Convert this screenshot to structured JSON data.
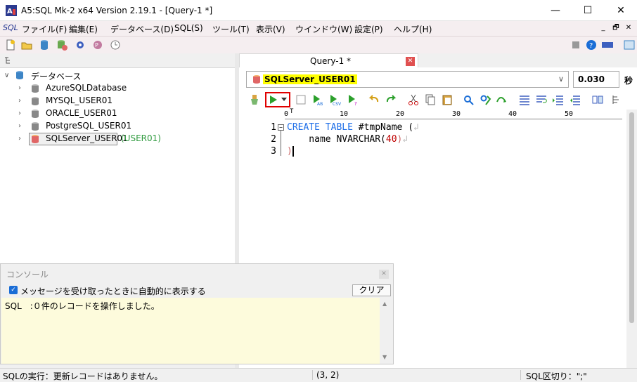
{
  "window": {
    "title": "A5:SQL Mk-2 x64 Version 2.19.1 - [Query-1 *]",
    "minimize_glyph": "—",
    "maximize_glyph": "☐",
    "close_glyph": "✕"
  },
  "menu": {
    "logo": "SQL",
    "items": [
      "ファイル(F)",
      "編集(E)",
      "データベース(D)",
      "SQL(S)",
      "ツール(T)",
      "表示(V)",
      "ウインドウ(W)",
      "設定(P)",
      "ヘルプ(H)"
    ],
    "mdi_min": "_",
    "mdi_restore": "🗗",
    "mdi_close": "✕"
  },
  "tree": {
    "root_label": "データベース",
    "items": [
      {
        "label": "AzureSQLDatabase"
      },
      {
        "label": "MYSQL_USER01"
      },
      {
        "label": "ORACLE_USER01"
      },
      {
        "label": "PostgreSQL_USER01"
      },
      {
        "label": "SQLServer_USER01",
        "suffix": "(USER01)"
      }
    ]
  },
  "tab": {
    "label": "Query-1 *",
    "close": "✕"
  },
  "connection": {
    "selected": "SQLServer_USER01",
    "elapsed": "0.030",
    "elapsed_unit": "秒"
  },
  "ruler": {
    "zero": "0",
    "ticks": [
      "10",
      "20",
      "30",
      "40",
      "50"
    ]
  },
  "editor": {
    "line_numbers": [
      "1",
      "2",
      "3"
    ],
    "line1_kw": "CREATE TABLE",
    "line1_rest": " #tmpName (",
    "line2_pre": "    name NVARCHAR(",
    "line2_num": "40",
    "line2_post": ")",
    "line3": ")",
    "eol_mark": "↲"
  },
  "console": {
    "title": "コンソール",
    "close": "✕",
    "auto_show_label": "メッセージを受け取ったときに自動的に表示する",
    "auto_show_checked": true,
    "clear_label": "クリア",
    "log": "SQL　:０件のレコードを操作しました。"
  },
  "status": {
    "message": "SQLの実行：更新レコードはありません。",
    "cursor": "(3, 2)",
    "delimiter": "SQL区切り：\";\""
  },
  "colors": {
    "accent_red": "#e00000",
    "keyword_blue": "#1f6fe8",
    "highlight_yellow": "#ffff00",
    "console_bg": "#fdfbdc",
    "tree_suffix_green": "#2e9a3e"
  }
}
